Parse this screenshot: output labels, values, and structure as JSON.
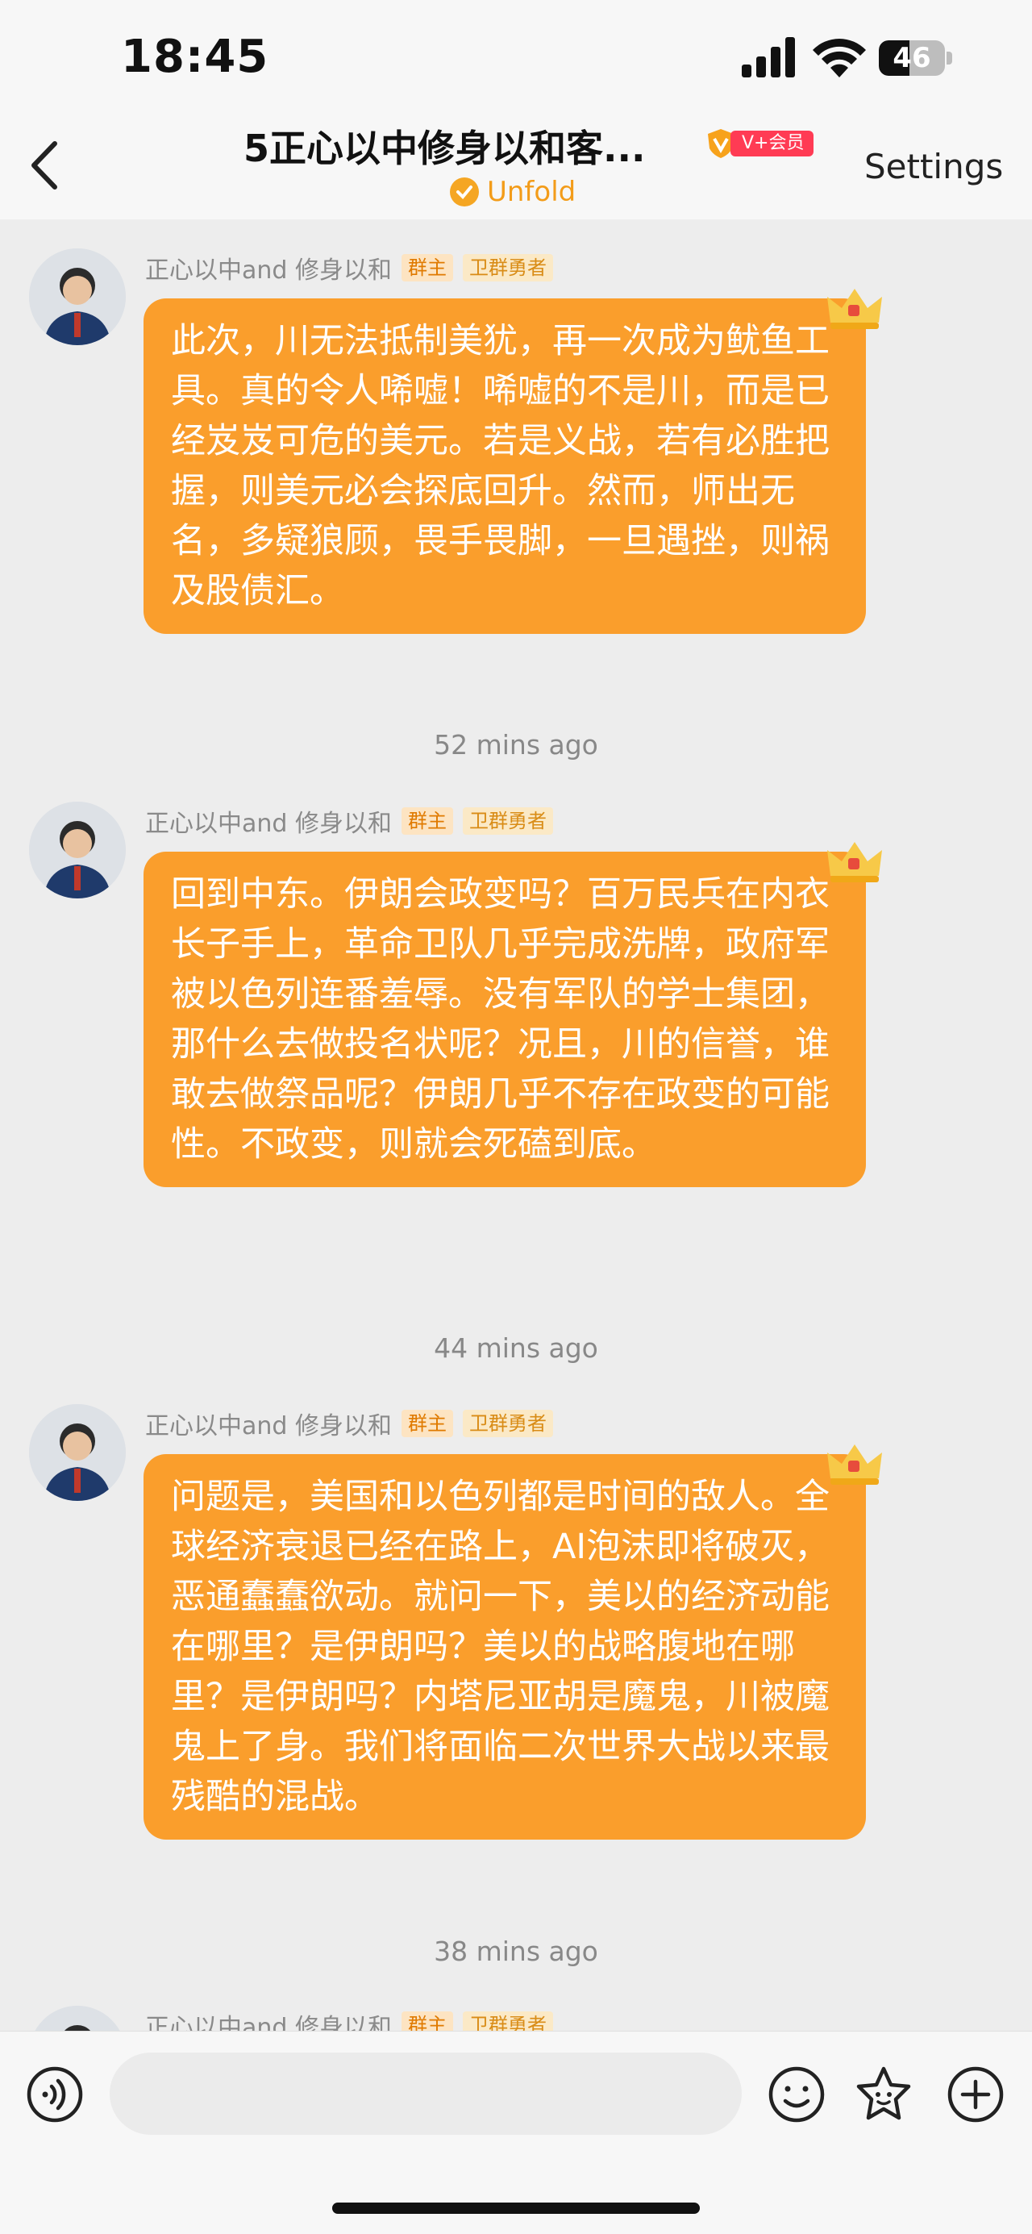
{
  "status_bar": {
    "time": "18:45",
    "battery_percent": "46",
    "battery_level": 0.46
  },
  "header": {
    "title": "5正心以中修身以和客...",
    "vip_badge": "V+会员",
    "subtitle": "Unfold",
    "settings_label": "Settings"
  },
  "messages": [
    {
      "sender": "正心以中and 修身以和",
      "badge_owner": "群主",
      "badge_hero": "卫群勇者",
      "text": "此次，川无法抵制美犹，再一次成为鱿鱼工具。真的令人唏嘘！唏嘘的不是川，而是已经岌岌可危的美元。若是义战，若有必胜把握，则美元必会探底回升。然而，师出无名，多疑狼顾，畏手畏脚，一旦遇挫，则祸及股债汇。"
    },
    {
      "sender": "正心以中and 修身以和",
      "badge_owner": "群主",
      "badge_hero": "卫群勇者",
      "text": "回到中东。伊朗会政变吗？百万民兵在内衣长子手上，革命卫队几乎完成洗牌，政府军被以色列连番羞辱。没有军队的学士集团，那什么去做投名状呢？况且，川的信誉，谁敢去做祭品呢？伊朗几乎不存在政变的可能性。不政变，则就会死磕到底。"
    },
    {
      "sender": "正心以中and 修身以和",
      "badge_owner": "群主",
      "badge_hero": "卫群勇者",
      "text": "问题是，美国和以色列都是时间的敌人。全球经济衰退已经在路上，AI泡沫即将破灭，恶通蠢蠢欲动。就问一下，美以的经济动能在哪里？是伊朗吗？美以的战略腹地在哪里？是伊朗吗？内塔尼亚胡是魔鬼，川被魔鬼上了身。我们将面临二次世界大战以来最残酷的混战。"
    },
    {
      "sender": "正心以中and 修身以和",
      "badge_owner": "群主",
      "badge_hero": "卫群勇者",
      "text": ""
    }
  ],
  "timestamps": [
    "52 mins ago",
    "44 mins ago",
    "38 mins ago"
  ],
  "input_bar": {
    "message_value": "",
    "placeholder": ""
  },
  "icons": {
    "back": "chevron-left-icon",
    "voice": "voice-icon",
    "emoji": "emoji-icon",
    "sticker": "sticker-icon",
    "add": "plus-icon"
  },
  "colors": {
    "bubble": "#fa9e2c",
    "accent": "#f39c19",
    "vip_red": "#ff3b54",
    "background": "#ededed"
  }
}
